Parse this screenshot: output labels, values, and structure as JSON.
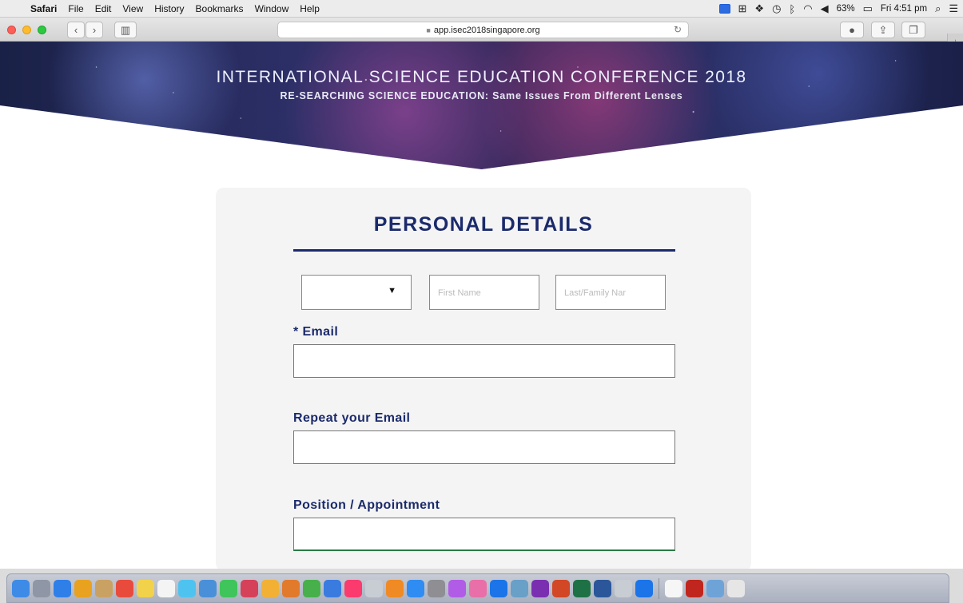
{
  "menubar": {
    "apple": "",
    "items": [
      "Safari",
      "File",
      "Edit",
      "View",
      "History",
      "Bookmarks",
      "Window",
      "Help"
    ],
    "battery": "63%",
    "clock": "Fri 4:51 pm"
  },
  "toolbar": {
    "url": "app.isec2018singapore.org"
  },
  "banner": {
    "title": "INTERNATIONAL SCIENCE EDUCATION CONFERENCE 2018",
    "subtitle": "RE-SEARCHING SCIENCE EDUCATION: Same Issues From Different Lenses"
  },
  "form": {
    "heading": "PERSONAL DETAILS",
    "salutation_value": "",
    "first_name_placeholder": "First Name",
    "last_name_placeholder": "Last/Family Nar",
    "email_label": "* Email",
    "repeat_email_label": "Repeat your Email",
    "position_label": "Position / Appointment"
  },
  "colors": {
    "heading": "#1b2a6b",
    "card_background": "#f4f4f4"
  },
  "dock_icons": [
    "finder-icon",
    "launchpad-icon",
    "safari-icon",
    "chrome-icon",
    "contacts-icon",
    "calendar-icon",
    "notes-icon",
    "reminders-icon",
    "messages-icon",
    "preview-icon",
    "facetime-icon",
    "photo-booth-icon",
    "photos-icon",
    "pages-icon",
    "numbers-icon",
    "keynote-icon",
    "itunes-icon",
    "help-icon",
    "ibooks-icon",
    "app-store-icon",
    "system-preferences-icon",
    "siri-icon",
    "ms-app-icon",
    "teamviewer-icon",
    "image-capture-icon",
    "onenote-icon",
    "powerpoint-icon",
    "excel-icon",
    "word-icon",
    "help-icon-2",
    "teamviewer-icon-2",
    "documents-icon",
    "acrobat-icon",
    "mail-stack-icon",
    "trash-icon"
  ]
}
